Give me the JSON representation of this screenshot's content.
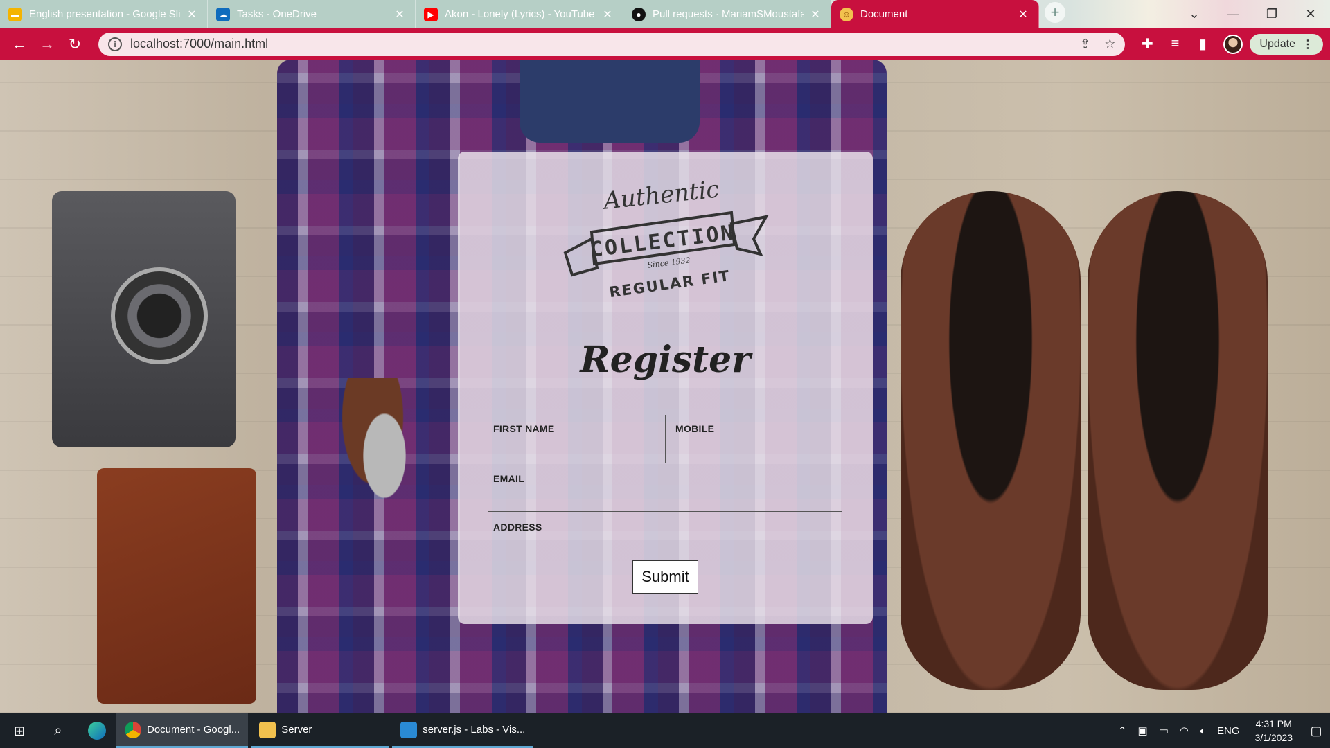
{
  "browser": {
    "tabs": [
      {
        "title": "English presentation - Google Sli",
        "icon": "google-slides-icon",
        "color": "#f4b400",
        "active": false
      },
      {
        "title": "Tasks - OneDrive",
        "icon": "onedrive-icon",
        "color": "#0f6cbd",
        "active": false
      },
      {
        "title": "Akon - Lonely (Lyrics) - YouTube",
        "icon": "youtube-icon",
        "color": "#ff0000",
        "active": false
      },
      {
        "title": "Pull requests · MariamSMoustafa",
        "icon": "github-icon",
        "color": "#111111",
        "active": false
      },
      {
        "title": "Document",
        "icon": "document-favicon-icon",
        "color": "#f2c14e",
        "active": true
      }
    ],
    "url": "localhost:7000/main.html",
    "update_label": "Update",
    "theme_color": "#c8103e"
  },
  "page": {
    "logo": {
      "line1": "Authentic",
      "line2": "COLLECTION",
      "line3": "Since 1932",
      "line4": "REGULAR FIT"
    },
    "title": "Register",
    "fields": {
      "first_name": {
        "label": "FIRST NAME",
        "value": ""
      },
      "mobile": {
        "label": "MOBILE",
        "value": ""
      },
      "email": {
        "label": "EMAIL",
        "value": ""
      },
      "address": {
        "label": "ADDRESS",
        "value": ""
      }
    },
    "submit_label": "Submit"
  },
  "taskbar": {
    "apps": [
      {
        "label": "Document - Googl...",
        "icon": "chrome-icon",
        "active": true
      },
      {
        "label": "Server",
        "icon": "folder-icon",
        "active": false
      },
      {
        "label": "server.js - Labs - Vis...",
        "icon": "vscode-icon",
        "active": false
      }
    ],
    "language": "ENG",
    "time": "4:31 PM",
    "date": "3/1/2023"
  }
}
